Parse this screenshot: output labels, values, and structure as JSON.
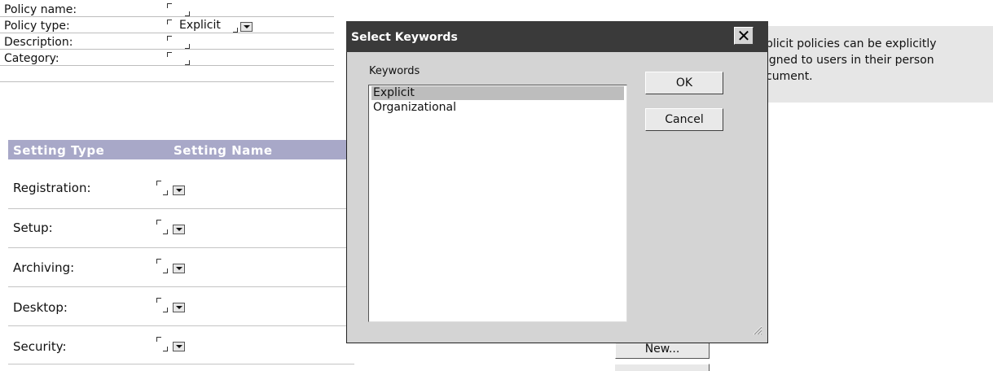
{
  "form": {
    "fields": [
      {
        "label": "Policy name:",
        "value": ""
      },
      {
        "label": "Policy type:",
        "value": "Explicit"
      },
      {
        "label": "Description:",
        "value": ""
      },
      {
        "label": "Category:",
        "value": ""
      }
    ]
  },
  "help": {
    "lines": [
      "plicit policies can be explicitly",
      "igned to users in their person",
      "cument."
    ]
  },
  "settings": {
    "headers": [
      "Setting Type",
      "Setting Name"
    ],
    "rows": [
      {
        "label": "Registration:"
      },
      {
        "label": "Setup:"
      },
      {
        "label": "Archiving:"
      },
      {
        "label": "Desktop:"
      },
      {
        "label": "Security:"
      }
    ],
    "new_button": "New..."
  },
  "dialog": {
    "title": "Select Keywords",
    "close_glyph": "✕",
    "list_label": "Keywords",
    "items": [
      {
        "label": "Explicit",
        "selected": true
      },
      {
        "label": "Organizational",
        "selected": false
      }
    ],
    "ok_label": "OK",
    "cancel_label": "Cancel"
  }
}
